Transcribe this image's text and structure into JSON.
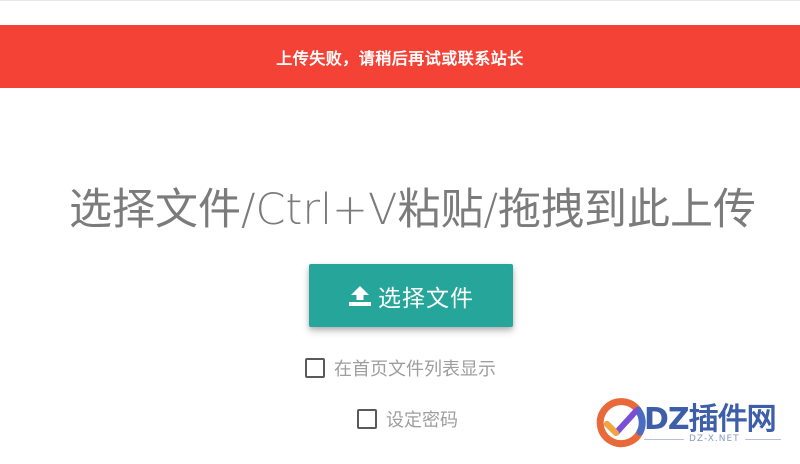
{
  "banner": {
    "message": "上传失败，请稍后再试或联系站长",
    "color": "#f44336"
  },
  "upload": {
    "headline": "选择文件/Ctrl+V粘贴/拖拽到此上传",
    "choose_button_label": "选择文件",
    "choose_button_icon": "upload-icon",
    "accent_color": "#26a69a"
  },
  "options": {
    "show_on_homepage": {
      "label": "在首页文件列表显示",
      "checked": false
    },
    "set_password": {
      "label": "设定密码",
      "checked": false
    }
  },
  "watermark": {
    "brand": "DZ插件网",
    "domain": "DZ-X.NET",
    "color": "#3d5ea8"
  }
}
